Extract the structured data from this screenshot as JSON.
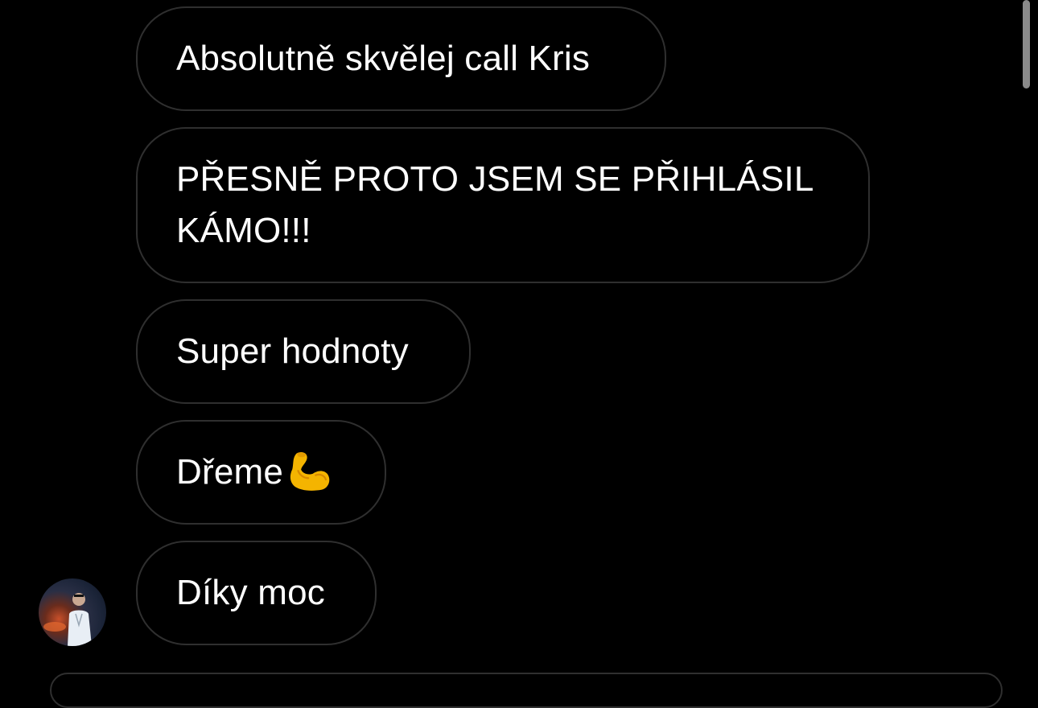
{
  "messages": [
    {
      "text": "Absolutně skvělej call Kris"
    },
    {
      "text": "PŘESNĚ PROTO JSEM SE PŘIHLÁSIL KÁMO!!!"
    },
    {
      "text": "Super hodnoty"
    },
    {
      "text": "Dřeme",
      "emoji": "flexed-biceps-icon"
    },
    {
      "text": "Díky moc"
    }
  ],
  "colors": {
    "background": "#000000",
    "bubble_border": "#2f2f2f",
    "text": "#ffffff",
    "scrollbar": "#8a8a8a"
  }
}
